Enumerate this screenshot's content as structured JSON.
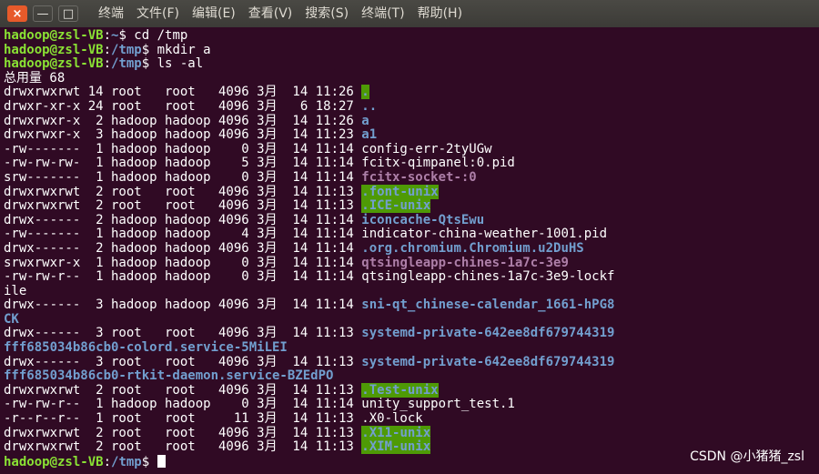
{
  "window": {
    "buttons": [
      "×",
      "—",
      "□"
    ],
    "menu": [
      "终端",
      "文件(F)",
      "编辑(E)",
      "查看(V)",
      "搜索(S)",
      "终端(T)",
      "帮助(H)"
    ]
  },
  "colors": {
    "background": "#300a24",
    "prompt_user": "#8ae234",
    "prompt_path": "#729fcf",
    "directory": "#729fcf",
    "socket": "#ad7fa8",
    "sticky_dir_bg": "#4e9a06"
  },
  "terminal": {
    "lines": [
      {
        "segs": [
          {
            "t": "hadoop@zsl-VB",
            "c": "p-user"
          },
          {
            "t": ":",
            "c": "c-white"
          },
          {
            "t": "~",
            "c": "p-path"
          },
          {
            "t": "$ cd /tmp",
            "c": "c-white"
          }
        ]
      },
      {
        "segs": [
          {
            "t": "hadoop@zsl-VB",
            "c": "p-user"
          },
          {
            "t": ":",
            "c": "c-white"
          },
          {
            "t": "/tmp",
            "c": "p-path"
          },
          {
            "t": "$ mkdir a",
            "c": "c-white"
          }
        ]
      },
      {
        "segs": [
          {
            "t": "hadoop@zsl-VB",
            "c": "p-user"
          },
          {
            "t": ":",
            "c": "c-white"
          },
          {
            "t": "/tmp",
            "c": "p-path"
          },
          {
            "t": "$ ls -al",
            "c": "c-white"
          }
        ]
      },
      {
        "segs": [
          {
            "t": "总用量 68",
            "c": "c-white"
          }
        ]
      },
      {
        "segs": [
          {
            "t": "drwxrwxrwt 14 root   root   4096 3月  14 11:26 ",
            "c": "c-white"
          },
          {
            "t": ".",
            "c": "sticky"
          }
        ]
      },
      {
        "segs": [
          {
            "t": "drwxr-xr-x 24 root   root   4096 3月   6 18:27 ",
            "c": "c-white"
          },
          {
            "t": "..",
            "c": "dir"
          }
        ]
      },
      {
        "segs": [
          {
            "t": "drwxrwxr-x  2 hadoop hadoop 4096 3月  14 11:26 ",
            "c": "c-white"
          },
          {
            "t": "a",
            "c": "dir"
          }
        ]
      },
      {
        "segs": [
          {
            "t": "drwxrwxr-x  3 hadoop hadoop 4096 3月  14 11:23 ",
            "c": "c-white"
          },
          {
            "t": "a1",
            "c": "dir"
          }
        ]
      },
      {
        "segs": [
          {
            "t": "-rw-------  1 hadoop hadoop    0 3月  14 11:14 config-err-2tyUGw",
            "c": "c-white"
          }
        ]
      },
      {
        "segs": [
          {
            "t": "-rw-rw-rw-  1 hadoop hadoop    5 3月  14 11:14 fcitx-qimpanel:0.pid",
            "c": "c-white"
          }
        ]
      },
      {
        "segs": [
          {
            "t": "srw-------  1 hadoop hadoop    0 3月  14 11:14 ",
            "c": "c-white"
          },
          {
            "t": "fcitx-socket-:0",
            "c": "sock"
          }
        ]
      },
      {
        "segs": [
          {
            "t": "drwxrwxrwt  2 root   root   4096 3月  14 11:13 ",
            "c": "c-white"
          },
          {
            "t": ".font-unix",
            "c": "sticky"
          }
        ]
      },
      {
        "segs": [
          {
            "t": "drwxrwxrwt  2 root   root   4096 3月  14 11:13 ",
            "c": "c-white"
          },
          {
            "t": ".ICE-unix",
            "c": "sticky"
          }
        ]
      },
      {
        "segs": [
          {
            "t": "drwx------  2 hadoop hadoop 4096 3月  14 11:14 ",
            "c": "c-white"
          },
          {
            "t": "iconcache-QtsEwu",
            "c": "dir"
          }
        ]
      },
      {
        "segs": [
          {
            "t": "-rw-------  1 hadoop hadoop    4 3月  14 11:14 indicator-china-weather-1001.pid",
            "c": "c-white"
          }
        ]
      },
      {
        "segs": [
          {
            "t": "drwx------  2 hadoop hadoop 4096 3月  14 11:14 ",
            "c": "c-white"
          },
          {
            "t": ".org.chromium.Chromium.u2DuHS",
            "c": "dir"
          }
        ]
      },
      {
        "segs": [
          {
            "t": "srwxrwxr-x  1 hadoop hadoop    0 3月  14 11:14 ",
            "c": "c-white"
          },
          {
            "t": "qtsingleapp-chines-1a7c-3e9",
            "c": "sock"
          }
        ]
      },
      {
        "segs": [
          {
            "t": "-rw-rw-r--  1 hadoop hadoop    0 3月  14 11:14 qtsingleapp-chines-1a7c-3e9-lockf",
            "c": "c-white"
          }
        ]
      },
      {
        "segs": [
          {
            "t": "ile",
            "c": "c-white"
          }
        ]
      },
      {
        "segs": [
          {
            "t": "drwx------  3 hadoop hadoop 4096 3月  14 11:14 ",
            "c": "c-white"
          },
          {
            "t": "sni-qt_chinese-calendar_1661-hPG8",
            "c": "dir"
          }
        ]
      },
      {
        "segs": [
          {
            "t": "CK",
            "c": "dir"
          }
        ]
      },
      {
        "segs": [
          {
            "t": "drwx------  3 root   root   4096 3月  14 11:13 ",
            "c": "c-white"
          },
          {
            "t": "systemd-private-642ee8df679744319",
            "c": "dir"
          }
        ]
      },
      {
        "segs": [
          {
            "t": "fff685034b86cb0-colord.service-5MiLEI",
            "c": "dir"
          }
        ]
      },
      {
        "segs": [
          {
            "t": "drwx------  3 root   root   4096 3月  14 11:13 ",
            "c": "c-white"
          },
          {
            "t": "systemd-private-642ee8df679744319",
            "c": "dir"
          }
        ]
      },
      {
        "segs": [
          {
            "t": "fff685034b86cb0-rtkit-daemon.service-BZEdPO",
            "c": "dir"
          }
        ]
      },
      {
        "segs": [
          {
            "t": "drwxrwxrwt  2 root   root   4096 3月  14 11:13 ",
            "c": "c-white"
          },
          {
            "t": ".Test-unix",
            "c": "sticky"
          }
        ]
      },
      {
        "segs": [
          {
            "t": "-rw-rw-r--  1 hadoop hadoop    0 3月  14 11:14 unity_support_test.1",
            "c": "c-white"
          }
        ]
      },
      {
        "segs": [
          {
            "t": "-r--r--r--  1 root   root     11 3月  14 11:13 .X0-lock",
            "c": "c-white"
          }
        ]
      },
      {
        "segs": [
          {
            "t": "drwxrwxrwt  2 root   root   4096 3月  14 11:13 ",
            "c": "c-white"
          },
          {
            "t": ".X11-unix",
            "c": "sticky"
          }
        ]
      },
      {
        "segs": [
          {
            "t": "drwxrwxrwt  2 root   root   4096 3月  14 11:13 ",
            "c": "c-white"
          },
          {
            "t": ".XIM-unix",
            "c": "sticky"
          }
        ]
      },
      {
        "segs": [
          {
            "t": "hadoop@zsl-VB",
            "c": "p-user"
          },
          {
            "t": ":",
            "c": "c-white"
          },
          {
            "t": "/tmp",
            "c": "p-path"
          },
          {
            "t": "$ ",
            "c": "c-white"
          }
        ],
        "cursor": true
      }
    ]
  },
  "watermark": "CSDN @小猪猪_zsl"
}
